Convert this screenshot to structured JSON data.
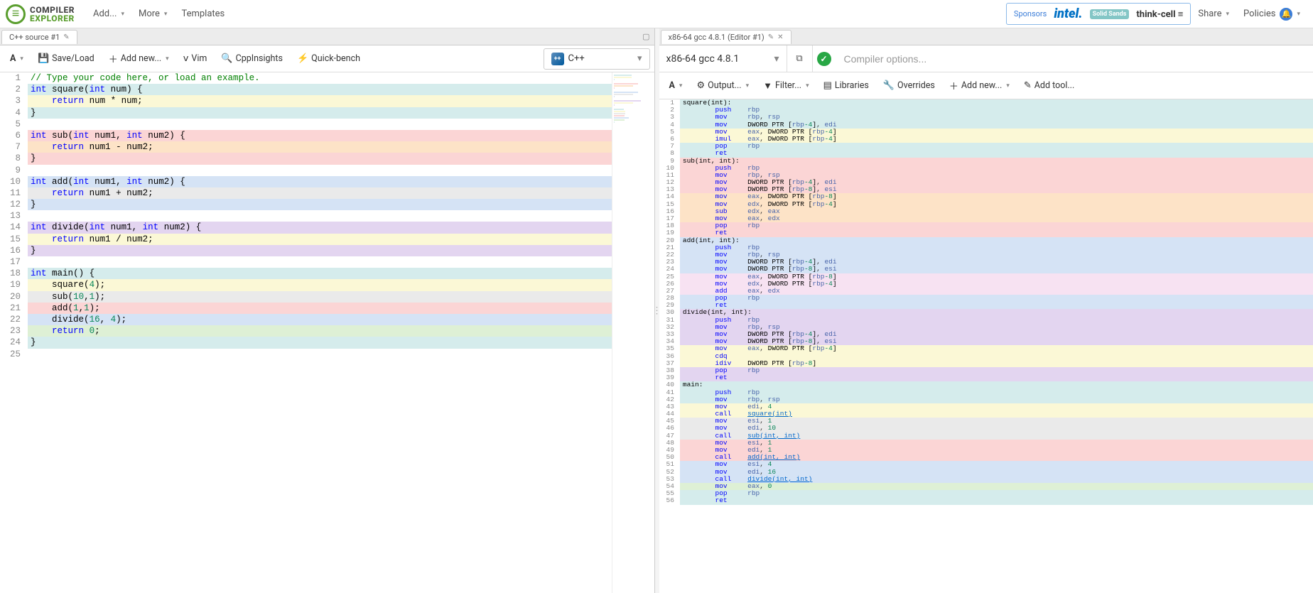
{
  "logo": {
    "line1": "COMPILER",
    "line2": "EXPLORER"
  },
  "nav": {
    "add": "Add...",
    "more": "More",
    "templates": "Templates",
    "share": "Share",
    "policies": "Policies"
  },
  "sponsors": {
    "label": "Sponsors",
    "intel": "intel.",
    "solidsands": "Solid Sands",
    "thinkcell": "think-cell ≡"
  },
  "sourceTab": {
    "title": "C++ source #1"
  },
  "compilerTab": {
    "title": "x86-64 gcc 4.8.1 (Editor #1)"
  },
  "sourceToolbar": {
    "font": "A",
    "saveLoad": "Save/Load",
    "addNew": "Add new...",
    "vim": "Vim",
    "cppInsights": "CppInsights",
    "quickBench": "Quick-bench"
  },
  "langSelect": {
    "label": "C++"
  },
  "compilerSelect": {
    "label": "x86-64 gcc 4.8.1"
  },
  "optionsPlaceholder": "Compiler options...",
  "asmToolbar": {
    "font": "A",
    "output": "Output...",
    "filter": "Filter...",
    "libraries": "Libraries",
    "overrides": "Overrides",
    "addNew": "Add new...",
    "addTool": "Add tool..."
  },
  "sourceLines": [
    {
      "n": 1,
      "bg": "none",
      "html": "<span class='c-comment'>// Type your code here, or load an example.</span>"
    },
    {
      "n": 2,
      "bg": "teal",
      "html": "<span class='c-type'>int</span> <span class='c-ident'>square</span><span class='c-paren'>(</span><span class='c-type'>int</span> <span class='c-ident'>num</span><span class='c-paren'>)</span> <span class='c-brace'>{</span>"
    },
    {
      "n": 3,
      "bg": "yellow",
      "html": "    <span class='c-keyword'>return</span> <span class='c-ident'>num</span> <span class='c-punct'>*</span> <span class='c-ident'>num</span><span class='c-punct'>;</span>"
    },
    {
      "n": 4,
      "bg": "teal",
      "html": "<span class='c-brace'>}</span>"
    },
    {
      "n": 5,
      "bg": "none",
      "html": ""
    },
    {
      "n": 6,
      "bg": "red",
      "html": "<span class='c-type'>int</span> <span class='c-ident'>sub</span><span class='c-paren'>(</span><span class='c-type'>int</span> <span class='c-ident'>num1</span><span class='c-punct'>,</span> <span class='c-type'>int</span> <span class='c-ident'>num2</span><span class='c-paren'>)</span> <span class='c-brace'>{</span>"
    },
    {
      "n": 7,
      "bg": "orange",
      "html": "    <span class='c-keyword'>return</span> <span class='c-ident'>num1</span> <span class='c-punct'>-</span> <span class='c-ident'>num2</span><span class='c-punct'>;</span>"
    },
    {
      "n": 8,
      "bg": "red",
      "html": "<span class='c-brace'>}</span>"
    },
    {
      "n": 9,
      "bg": "none",
      "html": ""
    },
    {
      "n": 10,
      "bg": "blue",
      "html": "<span class='c-type'>int</span> <span class='c-ident'>add</span><span class='c-paren'>(</span><span class='c-type'>int</span> <span class='c-ident'>num1</span><span class='c-punct'>,</span> <span class='c-type'>int</span> <span class='c-ident'>num2</span><span class='c-paren'>)</span> <span class='c-brace'>{</span>"
    },
    {
      "n": 11,
      "bg": "gray",
      "html": "    <span class='c-keyword'>return</span> <span class='c-ident'>num1</span> <span class='c-punct'>+</span> <span class='c-ident'>num2</span><span class='c-punct'>;</span>"
    },
    {
      "n": 12,
      "bg": "blue",
      "html": "<span class='c-brace'>}</span>"
    },
    {
      "n": 13,
      "bg": "none",
      "html": ""
    },
    {
      "n": 14,
      "bg": "purple",
      "html": "<span class='c-type'>int</span> <span class='c-ident'>divide</span><span class='c-paren'>(</span><span class='c-type'>int</span> <span class='c-ident'>num1</span><span class='c-punct'>,</span> <span class='c-type'>int</span> <span class='c-ident'>num2</span><span class='c-paren'>)</span> <span class='c-brace'>{</span>"
    },
    {
      "n": 15,
      "bg": "yellow",
      "html": "    <span class='c-keyword'>return</span> <span class='c-ident'>num1</span> <span class='c-punct'>/</span> <span class='c-ident'>num2</span><span class='c-punct'>;</span>"
    },
    {
      "n": 16,
      "bg": "purple",
      "html": "<span class='c-brace'>}</span>"
    },
    {
      "n": 17,
      "bg": "none",
      "html": ""
    },
    {
      "n": 18,
      "bg": "teal",
      "html": "<span class='c-type'>int</span> <span class='c-ident'>main</span><span class='c-paren'>()</span> <span class='c-brace'>{</span>"
    },
    {
      "n": 19,
      "bg": "yellow",
      "html": "    <span class='c-ident'>square</span><span class='c-paren'>(</span><span class='c-num'>4</span><span class='c-paren'>)</span><span class='c-punct'>;</span>"
    },
    {
      "n": 20,
      "bg": "gray",
      "html": "    <span class='c-ident'>sub</span><span class='c-paren'>(</span><span class='c-num'>10</span><span class='c-punct'>,</span><span class='c-num'>1</span><span class='c-paren'>)</span><span class='c-punct'>;</span>"
    },
    {
      "n": 21,
      "bg": "red",
      "html": "    <span class='c-ident'>add</span><span class='c-paren'>(</span><span class='c-num'>1</span><span class='c-punct'>,</span><span class='c-num'>1</span><span class='c-paren'>)</span><span class='c-punct'>;</span>"
    },
    {
      "n": 22,
      "bg": "blue",
      "html": "    <span class='c-ident'>divide</span><span class='c-paren'>(</span><span class='c-num'>16</span><span class='c-punct'>,</span> <span class='c-num'>4</span><span class='c-paren'>)</span><span class='c-punct'>;</span>"
    },
    {
      "n": 23,
      "bg": "green",
      "html": "    <span class='c-keyword'>return</span> <span class='c-num'>0</span><span class='c-punct'>;</span>"
    },
    {
      "n": 24,
      "bg": "teal",
      "html": "<span class='c-brace'>}</span>"
    },
    {
      "n": 25,
      "bg": "none",
      "html": ""
    }
  ],
  "asmLines": [
    {
      "n": 1,
      "bg": "teal",
      "html": "<span class='a-label'>square(int):</span>"
    },
    {
      "n": 2,
      "bg": "teal",
      "html": "        <span class='a-inst'>push</span>    <span class='a-reg'>rbp</span>"
    },
    {
      "n": 3,
      "bg": "teal",
      "html": "        <span class='a-inst'>mov</span>     <span class='a-reg'>rbp</span>, <span class='a-reg'>rsp</span>"
    },
    {
      "n": 4,
      "bg": "teal",
      "html": "        <span class='a-inst'>mov</span>     <span class='a-mem'>DWORD PTR [</span><span class='a-reg'>rbp</span><span class='a-num'>-4</span><span class='a-mem'>]</span>, <span class='a-reg'>edi</span>"
    },
    {
      "n": 5,
      "bg": "yellow",
      "html": "        <span class='a-inst'>mov</span>     <span class='a-reg'>eax</span>, <span class='a-mem'>DWORD PTR [</span><span class='a-reg'>rbp</span><span class='a-num'>-4</span><span class='a-mem'>]</span>"
    },
    {
      "n": 6,
      "bg": "yellow",
      "html": "        <span class='a-inst'>imul</span>    <span class='a-reg'>eax</span>, <span class='a-mem'>DWORD PTR [</span><span class='a-reg'>rbp</span><span class='a-num'>-4</span><span class='a-mem'>]</span>"
    },
    {
      "n": 7,
      "bg": "teal",
      "html": "        <span class='a-inst'>pop</span>     <span class='a-reg'>rbp</span>"
    },
    {
      "n": 8,
      "bg": "teal",
      "html": "        <span class='a-inst'>ret</span>"
    },
    {
      "n": 9,
      "bg": "red",
      "html": "<span class='a-label'>sub(int, int):</span>"
    },
    {
      "n": 10,
      "bg": "red",
      "html": "        <span class='a-inst'>push</span>    <span class='a-reg'>rbp</span>"
    },
    {
      "n": 11,
      "bg": "red",
      "html": "        <span class='a-inst'>mov</span>     <span class='a-reg'>rbp</span>, <span class='a-reg'>rsp</span>"
    },
    {
      "n": 12,
      "bg": "red",
      "html": "        <span class='a-inst'>mov</span>     <span class='a-mem'>DWORD PTR [</span><span class='a-reg'>rbp</span><span class='a-num'>-4</span><span class='a-mem'>]</span>, <span class='a-reg'>edi</span>"
    },
    {
      "n": 13,
      "bg": "red",
      "html": "        <span class='a-inst'>mov</span>     <span class='a-mem'>DWORD PTR [</span><span class='a-reg'>rbp</span><span class='a-num'>-8</span><span class='a-mem'>]</span>, <span class='a-reg'>esi</span>"
    },
    {
      "n": 14,
      "bg": "orange",
      "html": "        <span class='a-inst'>mov</span>     <span class='a-reg'>eax</span>, <span class='a-mem'>DWORD PTR [</span><span class='a-reg'>rbp</span><span class='a-num'>-8</span><span class='a-mem'>]</span>"
    },
    {
      "n": 15,
      "bg": "orange",
      "html": "        <span class='a-inst'>mov</span>     <span class='a-reg'>edx</span>, <span class='a-mem'>DWORD PTR [</span><span class='a-reg'>rbp</span><span class='a-num'>-4</span><span class='a-mem'>]</span>"
    },
    {
      "n": 16,
      "bg": "orange",
      "html": "        <span class='a-inst'>sub</span>     <span class='a-reg'>edx</span>, <span class='a-reg'>eax</span>"
    },
    {
      "n": 17,
      "bg": "orange",
      "html": "        <span class='a-inst'>mov</span>     <span class='a-reg'>eax</span>, <span class='a-reg'>edx</span>"
    },
    {
      "n": 18,
      "bg": "red",
      "html": "        <span class='a-inst'>pop</span>     <span class='a-reg'>rbp</span>"
    },
    {
      "n": 19,
      "bg": "red",
      "html": "        <span class='a-inst'>ret</span>"
    },
    {
      "n": 20,
      "bg": "blue",
      "html": "<span class='a-label'>add(int, int):</span>"
    },
    {
      "n": 21,
      "bg": "blue",
      "html": "        <span class='a-inst'>push</span>    <span class='a-reg'>rbp</span>"
    },
    {
      "n": 22,
      "bg": "blue",
      "html": "        <span class='a-inst'>mov</span>     <span class='a-reg'>rbp</span>, <span class='a-reg'>rsp</span>"
    },
    {
      "n": 23,
      "bg": "blue",
      "html": "        <span class='a-inst'>mov</span>     <span class='a-mem'>DWORD PTR [</span><span class='a-reg'>rbp</span><span class='a-num'>-4</span><span class='a-mem'>]</span>, <span class='a-reg'>edi</span>"
    },
    {
      "n": 24,
      "bg": "blue",
      "html": "        <span class='a-inst'>mov</span>     <span class='a-mem'>DWORD PTR [</span><span class='a-reg'>rbp</span><span class='a-num'>-8</span><span class='a-mem'>]</span>, <span class='a-reg'>esi</span>"
    },
    {
      "n": 25,
      "bg": "pink",
      "html": "        <span class='a-inst'>mov</span>     <span class='a-reg'>eax</span>, <span class='a-mem'>DWORD PTR [</span><span class='a-reg'>rbp</span><span class='a-num'>-8</span><span class='a-mem'>]</span>"
    },
    {
      "n": 26,
      "bg": "pink",
      "html": "        <span class='a-inst'>mov</span>     <span class='a-reg'>edx</span>, <span class='a-mem'>DWORD PTR [</span><span class='a-reg'>rbp</span><span class='a-num'>-4</span><span class='a-mem'>]</span>"
    },
    {
      "n": 27,
      "bg": "pink",
      "html": "        <span class='a-inst'>add</span>     <span class='a-reg'>eax</span>, <span class='a-reg'>edx</span>"
    },
    {
      "n": 28,
      "bg": "blue",
      "html": "        <span class='a-inst'>pop</span>     <span class='a-reg'>rbp</span>"
    },
    {
      "n": 29,
      "bg": "blue",
      "html": "        <span class='a-inst'>ret</span>"
    },
    {
      "n": 30,
      "bg": "purple",
      "html": "<span class='a-label'>divide(int, int):</span>"
    },
    {
      "n": 31,
      "bg": "purple",
      "html": "        <span class='a-inst'>push</span>    <span class='a-reg'>rbp</span>"
    },
    {
      "n": 32,
      "bg": "purple",
      "html": "        <span class='a-inst'>mov</span>     <span class='a-reg'>rbp</span>, <span class='a-reg'>rsp</span>"
    },
    {
      "n": 33,
      "bg": "purple",
      "html": "        <span class='a-inst'>mov</span>     <span class='a-mem'>DWORD PTR [</span><span class='a-reg'>rbp</span><span class='a-num'>-4</span><span class='a-mem'>]</span>, <span class='a-reg'>edi</span>"
    },
    {
      "n": 34,
      "bg": "purple",
      "html": "        <span class='a-inst'>mov</span>     <span class='a-mem'>DWORD PTR [</span><span class='a-reg'>rbp</span><span class='a-num'>-8</span><span class='a-mem'>]</span>, <span class='a-reg'>esi</span>"
    },
    {
      "n": 35,
      "bg": "yellow",
      "html": "        <span class='a-inst'>mov</span>     <span class='a-reg'>eax</span>, <span class='a-mem'>DWORD PTR [</span><span class='a-reg'>rbp</span><span class='a-num'>-4</span><span class='a-mem'>]</span>"
    },
    {
      "n": 36,
      "bg": "yellow",
      "html": "        <span class='a-inst'>cdq</span>"
    },
    {
      "n": 37,
      "bg": "yellow",
      "html": "        <span class='a-inst'>idiv</span>    <span class='a-mem'>DWORD PTR [</span><span class='a-reg'>rbp</span><span class='a-num'>-8</span><span class='a-mem'>]</span>"
    },
    {
      "n": 38,
      "bg": "purple",
      "html": "        <span class='a-inst'>pop</span>     <span class='a-reg'>rbp</span>"
    },
    {
      "n": 39,
      "bg": "purple",
      "html": "        <span class='a-inst'>ret</span>"
    },
    {
      "n": 40,
      "bg": "teal",
      "html": "<span class='a-label'>main:</span>"
    },
    {
      "n": 41,
      "bg": "teal",
      "html": "        <span class='a-inst'>push</span>    <span class='a-reg'>rbp</span>"
    },
    {
      "n": 42,
      "bg": "teal",
      "html": "        <span class='a-inst'>mov</span>     <span class='a-reg'>rbp</span>, <span class='a-reg'>rsp</span>"
    },
    {
      "n": 43,
      "bg": "yellow",
      "html": "        <span class='a-inst'>mov</span>     <span class='a-reg'>edi</span>, <span class='a-num'>4</span>"
    },
    {
      "n": 44,
      "bg": "yellow",
      "html": "        <span class='a-inst'>call</span>    <span class='a-link'>square(int)</span>"
    },
    {
      "n": 45,
      "bg": "gray",
      "html": "        <span class='a-inst'>mov</span>     <span class='a-reg'>esi</span>, <span class='a-num'>1</span>"
    },
    {
      "n": 46,
      "bg": "gray",
      "html": "        <span class='a-inst'>mov</span>     <span class='a-reg'>edi</span>, <span class='a-num'>10</span>"
    },
    {
      "n": 47,
      "bg": "gray",
      "html": "        <span class='a-inst'>call</span>    <span class='a-link'>sub(int, int)</span>"
    },
    {
      "n": 48,
      "bg": "red",
      "html": "        <span class='a-inst'>mov</span>     <span class='a-reg'>esi</span>, <span class='a-num'>1</span>"
    },
    {
      "n": 49,
      "bg": "red",
      "html": "        <span class='a-inst'>mov</span>     <span class='a-reg'>edi</span>, <span class='a-num'>1</span>"
    },
    {
      "n": 50,
      "bg": "red",
      "html": "        <span class='a-inst'>call</span>    <span class='a-link'>add(int, int)</span>"
    },
    {
      "n": 51,
      "bg": "blue",
      "html": "        <span class='a-inst'>mov</span>     <span class='a-reg'>esi</span>, <span class='a-num'>4</span>"
    },
    {
      "n": 52,
      "bg": "blue",
      "html": "        <span class='a-inst'>mov</span>     <span class='a-reg'>edi</span>, <span class='a-num'>16</span>"
    },
    {
      "n": 53,
      "bg": "blue",
      "html": "        <span class='a-inst'>call</span>    <span class='a-link'>divide(int, int)</span>"
    },
    {
      "n": 54,
      "bg": "green",
      "html": "        <span class='a-inst'>mov</span>     <span class='a-reg'>eax</span>, <span class='a-num'>0</span>"
    },
    {
      "n": 55,
      "bg": "teal",
      "html": "        <span class='a-inst'>pop</span>     <span class='a-reg'>rbp</span>"
    },
    {
      "n": 56,
      "bg": "teal",
      "html": "        <span class='a-inst'>ret</span>"
    }
  ]
}
